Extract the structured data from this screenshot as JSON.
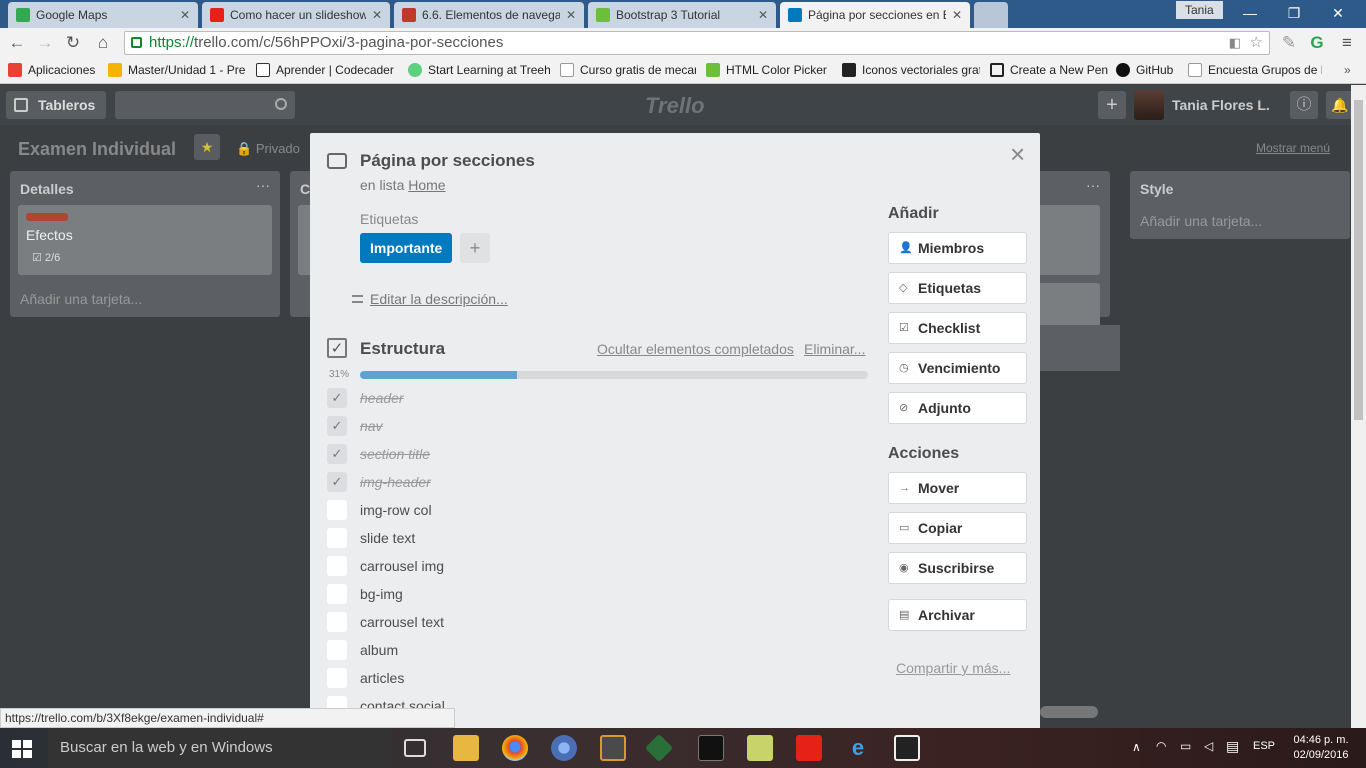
{
  "browser": {
    "tabs": [
      {
        "label": "Google Maps",
        "color": "#34a853"
      },
      {
        "label": "Como hacer un slideshow",
        "color": "#e62117"
      },
      {
        "label": "6.6. Elementos de navegac",
        "color": "#c0392b"
      },
      {
        "label": "Bootstrap 3 Tutorial",
        "color": "#6cbf3a"
      },
      {
        "label": "Página por secciones en E",
        "color": "#0079bf"
      }
    ],
    "user_chip": "Tania",
    "url_scheme": "https://",
    "url_rest": "trello.com/c/56hPPOxi/3-pagina-por-secciones"
  },
  "bookmarks": [
    {
      "label": "Aplicaciones",
      "color": "#e94235"
    },
    {
      "label": "Master/Unidad 1 - Pre",
      "color": "#f4b400"
    },
    {
      "label": "Aprender | Codecader",
      "color": "#333333"
    },
    {
      "label": "Start Learning at Treeh",
      "color": "#5fcf80"
    },
    {
      "label": "Curso gratis de mecan",
      "color": "#999999"
    },
    {
      "label": "HTML Color Picker",
      "color": "#6cbf3a"
    },
    {
      "label": "Iconos vectoriales grat",
      "color": "#222222"
    },
    {
      "label": "Create a New Pen",
      "color": "#222222"
    },
    {
      "label": "GitHub",
      "color": "#111111"
    },
    {
      "label": "Encuesta Grupos de E",
      "color": "#999999"
    }
  ],
  "trello_header": {
    "boards_label": "Tableros",
    "logo": "Trello",
    "user_name": "Tania Flores L."
  },
  "board": {
    "title": "Examen Individual",
    "privacy": "Privado",
    "show_menu": "Mostrar menú",
    "lists": [
      {
        "title": "Detalles",
        "card_title": "Efectos",
        "card_badge": "2/6",
        "add_card": "Añadir una tarjeta..."
      },
      {
        "title": "C"
      },
      {
        "title": "Style",
        "add_card": "Añadir una tarjeta..."
      }
    ]
  },
  "modal": {
    "title": "Página por secciones",
    "in_list_prefix": "en lista",
    "list_name": "Home",
    "labels_heading": "Etiquetas",
    "label_important": "Importante",
    "label_add": "+",
    "edit_description": "Editar la descripción...",
    "checklist": {
      "title": "Estructura",
      "hide_completed": "Ocultar elementos completados",
      "delete": "Eliminar...",
      "progress_text": "31%",
      "progress": 0.31,
      "items": [
        {
          "text": "header",
          "done": true
        },
        {
          "text": "nav",
          "done": true
        },
        {
          "text": "section title",
          "done": true
        },
        {
          "text": "img-header",
          "done": true
        },
        {
          "text": "img-row col",
          "done": false
        },
        {
          "text": "slide text",
          "done": false
        },
        {
          "text": "carrousel img",
          "done": false
        },
        {
          "text": "bg-img",
          "done": false
        },
        {
          "text": "carrousel text",
          "done": false
        },
        {
          "text": "album",
          "done": false
        },
        {
          "text": "articles",
          "done": false
        },
        {
          "text": "contact social",
          "done": false
        }
      ]
    },
    "add_heading": "Añadir",
    "add_buttons": [
      "Miembros",
      "Etiquetas",
      "Checklist",
      "Vencimiento",
      "Adjunto"
    ],
    "actions_heading": "Acciones",
    "action_buttons": [
      "Mover",
      "Copiar",
      "Suscribirse"
    ],
    "archive": "Archivar",
    "share": "Compartir y más..."
  },
  "status_url": "https://trello.com/b/3Xf8ekge/examen-individual#",
  "taskbar": {
    "search": "Buscar en la web y en Windows",
    "lang": "ESP",
    "time": "04:46 p. m.",
    "date": "02/09/2016"
  }
}
